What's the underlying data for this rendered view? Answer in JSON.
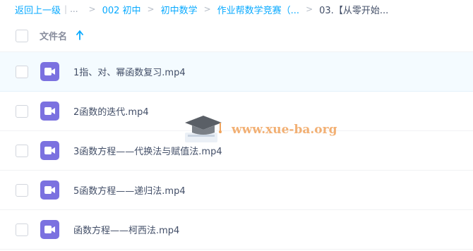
{
  "breadcrumb": {
    "back": "返回上一级",
    "separator": "|",
    "ellipsis": "...",
    "items": [
      "002 初中",
      "初中数学",
      "作业帮数学竞赛（...",
      "03.【从零开始..."
    ]
  },
  "header": {
    "column_label": "文件名",
    "sort_icon": "arrow-up-icon"
  },
  "files": [
    {
      "name": "1指、对、幂函数复习.mp4",
      "icon": "video-file-icon",
      "selected": true
    },
    {
      "name": "2函数的迭代.mp4",
      "icon": "video-file-icon",
      "selected": false
    },
    {
      "name": "3函数方程——代换法与赋值法.mp4",
      "icon": "video-file-icon",
      "selected": false
    },
    {
      "name": "5函数方程——递归法.mp4",
      "icon": "video-file-icon",
      "selected": false
    },
    {
      "name": "函数方程——柯西法.mp4",
      "icon": "video-file-icon",
      "selected": false
    }
  ],
  "watermark": {
    "text": "www.xue-ba.org",
    "icon": "graduation-cap-icon"
  },
  "colors": {
    "link": "#09aaff",
    "text": "#424e67",
    "video_icon": "#7b71e0",
    "selected_row": "#f4fbff"
  }
}
